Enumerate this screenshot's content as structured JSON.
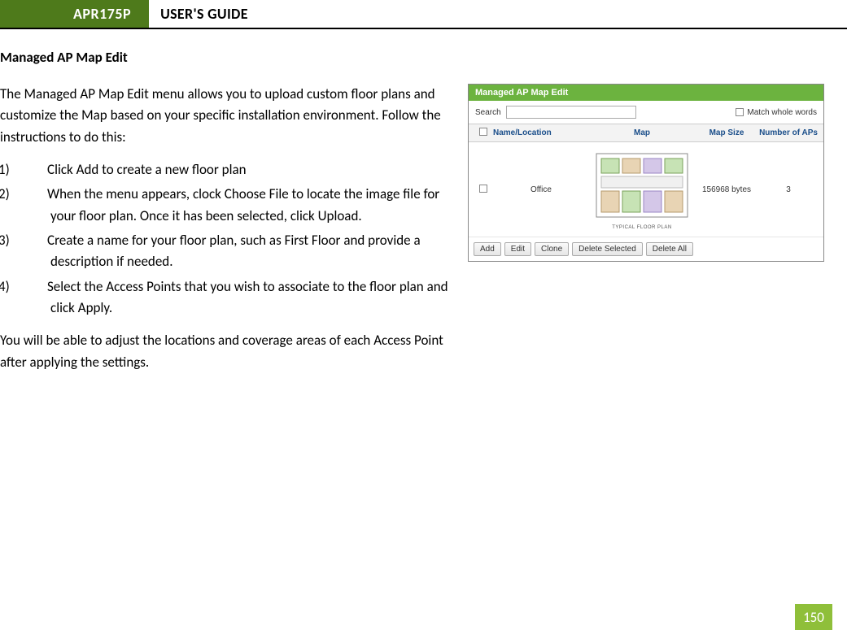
{
  "header": {
    "product": "APR175P",
    "title": "USER'S GUIDE"
  },
  "section_title": "Managed AP Map Edit",
  "intro": "The Managed AP Map Edit menu allows you to upload custom floor plans and customize the Map based on your specific installation environment. Follow the instructions to do this:",
  "steps": [
    "Click Add to create a new floor plan",
    "When the menu appears, clock Choose File to locate the image file for your floor plan. Once it has been selected, click Upload.",
    "Create a name for your floor plan, such as First Floor and provide a description if needed.",
    "Select the Access Points that you wish to associate to the floor plan and click Apply."
  ],
  "outro": "You will be able to adjust the locations and coverage areas of each Access Point after applying the settings.",
  "screenshot": {
    "title": "Managed AP Map Edit",
    "search_label": "Search",
    "match_label": "Match whole words",
    "columns": {
      "name": "Name/Location",
      "map": "Map",
      "size": "Map Size",
      "num": "Number of APs"
    },
    "row": {
      "name": "Office",
      "size": "156968 bytes",
      "num": "3",
      "plan_caption": "TYPICAL FLOOR PLAN"
    },
    "buttons": {
      "add": "Add",
      "edit": "Edit",
      "clone": "Clone",
      "del_sel": "Delete Selected",
      "del_all": "Delete All"
    }
  },
  "page_number": "150"
}
